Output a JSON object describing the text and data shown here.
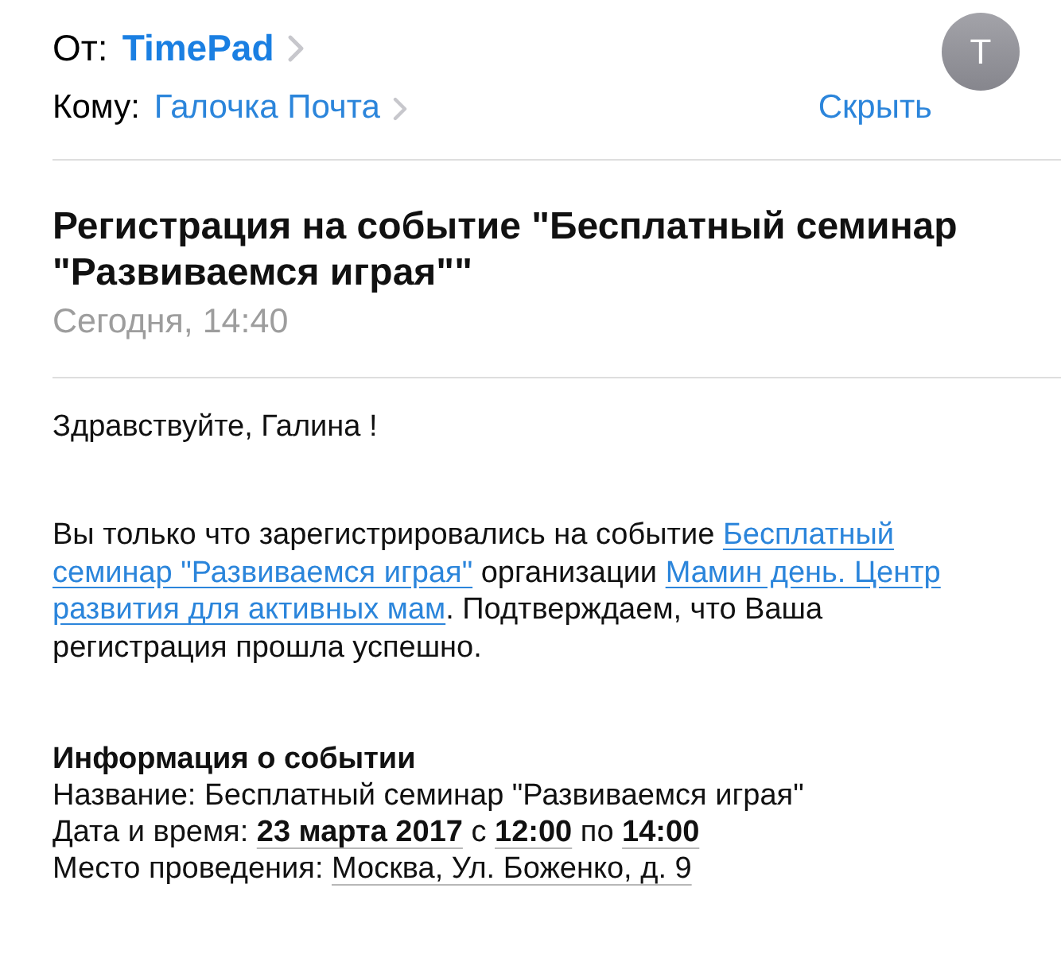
{
  "header": {
    "from_label": "От:",
    "from_name": "TimePad",
    "to_label": "Кому:",
    "to_name": "Галочка Почта",
    "hide_link": "Скрыть",
    "avatar_letter": "T"
  },
  "subject": "Регистрация на событие \"Бесплатный семинар \"Развиваемся играя\"\"",
  "date": "Сегодня, 14:40",
  "body": {
    "greeting": "Здравствуйте, Галина !",
    "paragraph": [
      {
        "kind": "text",
        "text": "Вы только что зарегистрировались на событие "
      },
      {
        "kind": "link",
        "parts": [
          "Бесплатный",
          "семинар \"Развиваемся играя\""
        ]
      },
      {
        "kind": "text",
        "text": " организации "
      },
      {
        "kind": "link",
        "parts": [
          "Мамин день. Центр",
          "развития для активных мам"
        ]
      },
      {
        "kind": "text",
        "text": ". Подтверждаем, что Ваша регистрация прошла успешно."
      }
    ],
    "info_title": "Информация о событии",
    "info_rows": [
      [
        {
          "kind": "text",
          "text": "Название: Бесплатный семинар \"Развиваемся играя\""
        }
      ],
      [
        {
          "kind": "text",
          "text": "Дата и время: "
        },
        {
          "kind": "detected",
          "bold": true,
          "text": "23 марта 2017"
        },
        {
          "kind": "text",
          "text": " с "
        },
        {
          "kind": "detected",
          "bold": true,
          "text": "12:00"
        },
        {
          "kind": "text",
          "text": " по "
        },
        {
          "kind": "detected",
          "bold": true,
          "text": "14:00"
        }
      ],
      [
        {
          "kind": "text",
          "text": "Место проведения: "
        },
        {
          "kind": "detected",
          "bold": false,
          "text": "Москва, Ул. Боженко, д. 9"
        }
      ]
    ]
  }
}
